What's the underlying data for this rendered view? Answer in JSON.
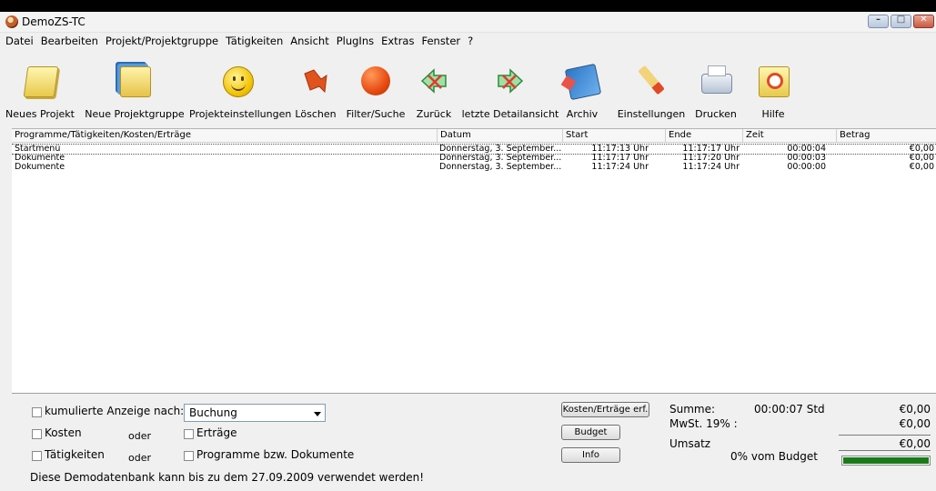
{
  "window": {
    "title": "DemoZS-TC",
    "controls": {
      "minimize": "–",
      "maximize": "□",
      "close": "✕"
    }
  },
  "menu": [
    "Datei",
    "Bearbeiten",
    "Projekt/Projektgruppe",
    "Tätigkeiten",
    "Ansicht",
    "PlugIns",
    "Extras",
    "Fenster",
    "?"
  ],
  "toolbar": [
    {
      "label": "Neues Projekt",
      "icon": "new-project-icon"
    },
    {
      "label": "Neue Projektgruppe",
      "icon": "new-project-group-icon"
    },
    {
      "label": "Projekteinstellungen",
      "icon": "smiley-icon"
    },
    {
      "label": "Löschen",
      "icon": "delete-icon"
    },
    {
      "label": "Filter/Suche",
      "icon": "filter-icon"
    },
    {
      "label": "Zurück",
      "icon": "back-arrow-icon"
    },
    {
      "label": "letzte Detailansicht",
      "icon": "forward-arrow-icon"
    },
    {
      "label": "Archiv",
      "icon": "archive-icon"
    },
    {
      "label": "Einstellungen",
      "icon": "pencil-icon"
    },
    {
      "label": "Drucken",
      "icon": "printer-icon"
    },
    {
      "label": "Hilfe",
      "icon": "help-icon"
    }
  ],
  "list": {
    "columns": [
      "Programme/Tätigkeiten/Kosten/Erträge",
      "Datum",
      "Start",
      "Ende",
      "Zeit",
      "Betrag"
    ],
    "rows": [
      {
        "name": "Startmenü",
        "datum": "Donnerstag, 3. September...",
        "start": "11:17:13 Uhr",
        "ende": "11:17:17 Uhr",
        "zeit": "00:00:04",
        "betrag": "€0,00"
      },
      {
        "name": "Dokumente",
        "datum": "Donnerstag, 3. September...",
        "start": "11:17:17 Uhr",
        "ende": "11:17:20 Uhr",
        "zeit": "00:00:03",
        "betrag": "€0,00"
      },
      {
        "name": "Dokumente",
        "datum": "Donnerstag, 3. September...",
        "start": "11:17:24 Uhr",
        "ende": "11:17:24 Uhr",
        "zeit": "00:00:00",
        "betrag": "€0,00"
      }
    ]
  },
  "bottom": {
    "kumuliert_label": "kumulierte Anzeige nach:",
    "combo_value": "Buchung",
    "kosten_label": "Kosten",
    "oder1": "oder",
    "ertraege_label": "Erträge",
    "taetigkeiten_label": "Tätigkeiten",
    "oder2": "oder",
    "programme_label": "Programme bzw. Dokumente",
    "demo_notice": "Diese Demodatenbank kann bis zu dem 27.09.2009 verwendet werden!",
    "btn_kosten": "Kosten/Erträge erf.",
    "btn_budget": "Budget",
    "btn_info": "Info",
    "summe_label": "Summe:",
    "summe_value": "00:00:07 Std",
    "summe_betrag": "€0,00",
    "mwst_label": "MwSt. 19% :",
    "mwst_betrag": "€0,00",
    "umsatz_label": "Umsatz",
    "umsatz_betrag": "€0,00",
    "budget_text": "0% vom Budget",
    "budget_fill_fraction": 1.0
  },
  "colors": {
    "budget_bar": "#1a7a1a",
    "list_bg": "#ffffff",
    "window_bg": "#f0f0f0"
  }
}
